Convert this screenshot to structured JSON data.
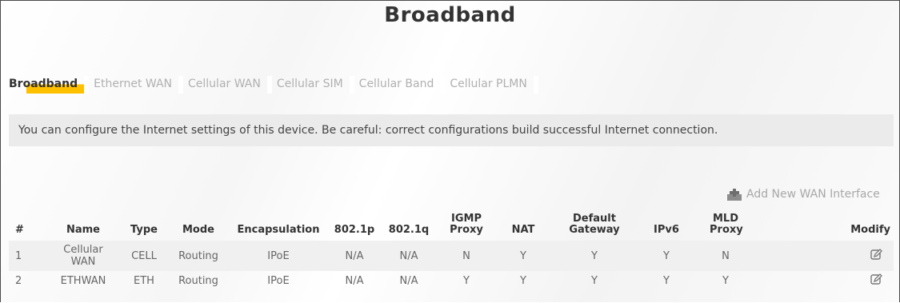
{
  "page": {
    "title": "Broadband"
  },
  "tabs": [
    {
      "label": "Broadband",
      "active": true
    },
    {
      "label": "Ethernet WAN",
      "active": false
    },
    {
      "label": "Cellular WAN",
      "active": false
    },
    {
      "label": "Cellular SIM",
      "active": false
    },
    {
      "label": "Cellular Band",
      "active": false
    },
    {
      "label": "Cellular PLMN",
      "active": false
    }
  ],
  "info": {
    "text": "You can configure the Internet settings of this device. Be careful: correct configurations build successful Internet connection."
  },
  "actions": {
    "add_wan_label": "Add New WAN Interface",
    "add_icon": "plus-icon"
  },
  "table": {
    "headers": [
      "#",
      "Name",
      "Type",
      "Mode",
      "Encapsulation",
      "802.1p",
      "802.1q",
      "IGMP Proxy",
      "NAT",
      "Default Gateway",
      "IPv6",
      "MLD Proxy",
      "Modify"
    ],
    "rows": [
      {
        "num": "1",
        "name": "Cellular WAN",
        "type": "CELL",
        "mode": "Routing",
        "encapsulation": "IPoE",
        "p8021p": "N/A",
        "p8021q": "N/A",
        "igmp": "N",
        "nat": "Y",
        "gateway": "Y",
        "ipv6": "Y",
        "mld": "N",
        "modify_icon": "edit-icon"
      },
      {
        "num": "2",
        "name": "ETHWAN",
        "type": "ETH",
        "mode": "Routing",
        "encapsulation": "IPoE",
        "p8021p": "N/A",
        "p8021q": "N/A",
        "igmp": "Y",
        "nat": "Y",
        "gateway": "Y",
        "ipv6": "Y",
        "mld": "Y",
        "modify_icon": "edit-icon"
      }
    ]
  },
  "colors": {
    "accent": "#ffc000",
    "info_bg": "#ebebeb",
    "row_alt": "#f0f0f0"
  }
}
